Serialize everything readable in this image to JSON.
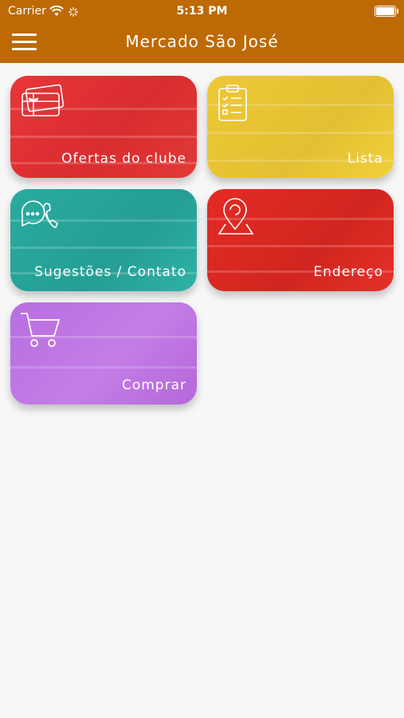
{
  "status_bar": {
    "carrier": "Carrier",
    "time": "5:13 PM"
  },
  "header": {
    "title": "Mercado São José",
    "menu_icon": "hamburger-menu-icon"
  },
  "tiles": [
    {
      "label": "Ofertas do clube",
      "icon": "gift-card-icon",
      "color": "#e0302f"
    },
    {
      "label": "Lista",
      "icon": "clipboard-checklist-icon",
      "color": "#e8c435"
    },
    {
      "label": "Sugestões / Contato",
      "icon": "chat-phone-icon",
      "color": "#28a79b"
    },
    {
      "label": "Endereço",
      "icon": "map-pin-icon",
      "color": "#dc2a23"
    },
    {
      "label": "Comprar",
      "icon": "shopping-cart-icon",
      "color": "#bd72e2"
    }
  ]
}
